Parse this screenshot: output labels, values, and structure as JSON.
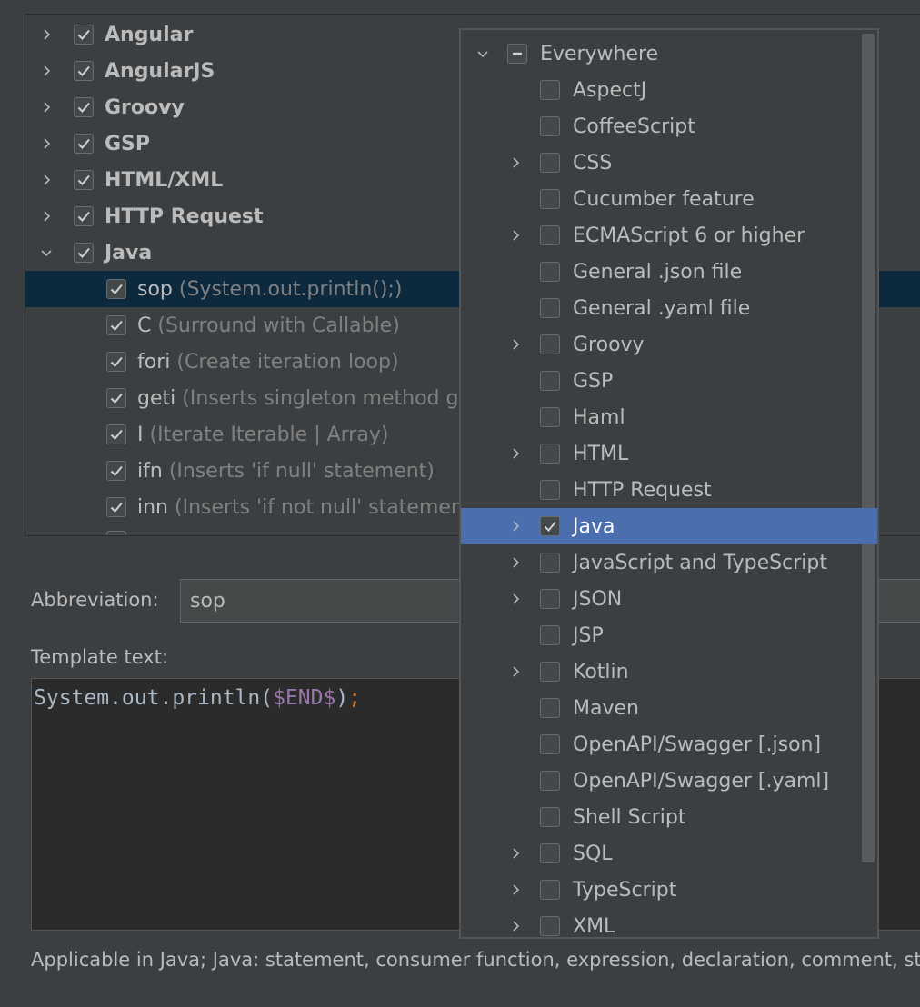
{
  "groups": [
    {
      "label": "Angular",
      "expanded": false,
      "checked": true
    },
    {
      "label": "AngularJS",
      "expanded": false,
      "checked": true
    },
    {
      "label": "Groovy",
      "expanded": false,
      "checked": true
    },
    {
      "label": "GSP",
      "expanded": false,
      "checked": true
    },
    {
      "label": "HTML/XML",
      "expanded": false,
      "checked": true
    },
    {
      "label": "HTTP Request",
      "expanded": false,
      "checked": true
    },
    {
      "label": "Java",
      "expanded": true,
      "checked": true
    }
  ],
  "templates": [
    {
      "abbr": "sop",
      "desc": "(System.out.println();)",
      "checked": true,
      "selected": true
    },
    {
      "abbr": "C",
      "desc": "(Surround with Callable)",
      "checked": true
    },
    {
      "abbr": "fori",
      "desc": "(Create iteration loop)",
      "checked": true
    },
    {
      "abbr": "geti",
      "desc": "(Inserts singleton method ge",
      "checked": true
    },
    {
      "abbr": "I",
      "desc": "(Iterate Iterable | Array)",
      "checked": true
    },
    {
      "abbr": "ifn",
      "desc": "(Inserts 'if null' statement)",
      "checked": true
    },
    {
      "abbr": "inn",
      "desc": "(Inserts 'if not null' statement",
      "checked": true
    }
  ],
  "form": {
    "abbreviation_label": "Abbreviation:",
    "abbreviation_value": "sop",
    "template_text_label": "Template text:",
    "code_prefix": "System.out.println(",
    "code_var": "$END$",
    "code_close": ")",
    "code_semi": ";"
  },
  "applicable_text": "Applicable in Java; Java: statement, consumer function, expression, declaration, comment, st",
  "context_popup": {
    "items": [
      {
        "label": "Everywhere",
        "expandable": true,
        "expanded": true,
        "state": "partial",
        "level": 0
      },
      {
        "label": "AspectJ",
        "expandable": false,
        "state": "unchecked",
        "level": 1
      },
      {
        "label": "CoffeeScript",
        "expandable": false,
        "state": "unchecked",
        "level": 1
      },
      {
        "label": "CSS",
        "expandable": true,
        "state": "unchecked",
        "level": 1
      },
      {
        "label": "Cucumber feature",
        "expandable": false,
        "state": "unchecked",
        "level": 1
      },
      {
        "label": "ECMAScript 6 or higher",
        "expandable": true,
        "state": "unchecked",
        "level": 1
      },
      {
        "label": "General .json file",
        "expandable": false,
        "state": "unchecked",
        "level": 1
      },
      {
        "label": "General .yaml file",
        "expandable": false,
        "state": "unchecked",
        "level": 1
      },
      {
        "label": "Groovy",
        "expandable": true,
        "state": "unchecked",
        "level": 1
      },
      {
        "label": "GSP",
        "expandable": false,
        "state": "unchecked",
        "level": 1
      },
      {
        "label": "Haml",
        "expandable": false,
        "state": "unchecked",
        "level": 1
      },
      {
        "label": "HTML",
        "expandable": true,
        "state": "unchecked",
        "level": 1
      },
      {
        "label": "HTTP Request",
        "expandable": false,
        "state": "unchecked",
        "level": 1
      },
      {
        "label": "Java",
        "expandable": true,
        "state": "checked",
        "level": 1,
        "selected": true
      },
      {
        "label": "JavaScript and TypeScript",
        "expandable": true,
        "state": "unchecked",
        "level": 1
      },
      {
        "label": "JSON",
        "expandable": true,
        "state": "unchecked",
        "level": 1
      },
      {
        "label": "JSP",
        "expandable": false,
        "state": "unchecked",
        "level": 1
      },
      {
        "label": "Kotlin",
        "expandable": true,
        "state": "unchecked",
        "level": 1
      },
      {
        "label": "Maven",
        "expandable": false,
        "state": "unchecked",
        "level": 1
      },
      {
        "label": "OpenAPI/Swagger [.json]",
        "expandable": false,
        "state": "unchecked",
        "level": 1
      },
      {
        "label": "OpenAPI/Swagger [.yaml]",
        "expandable": false,
        "state": "unchecked",
        "level": 1
      },
      {
        "label": "Shell Script",
        "expandable": false,
        "state": "unchecked",
        "level": 1
      },
      {
        "label": "SQL",
        "expandable": true,
        "state": "unchecked",
        "level": 1
      },
      {
        "label": "TypeScript",
        "expandable": true,
        "state": "unchecked",
        "level": 1
      },
      {
        "label": "XML",
        "expandable": true,
        "state": "unchecked",
        "level": 1
      }
    ]
  },
  "colors": {
    "background": "#3c3f41",
    "tree_selection": "#0d293e",
    "popup_selection": "#4b6eaf",
    "editor_bg": "#2b2b2b"
  }
}
